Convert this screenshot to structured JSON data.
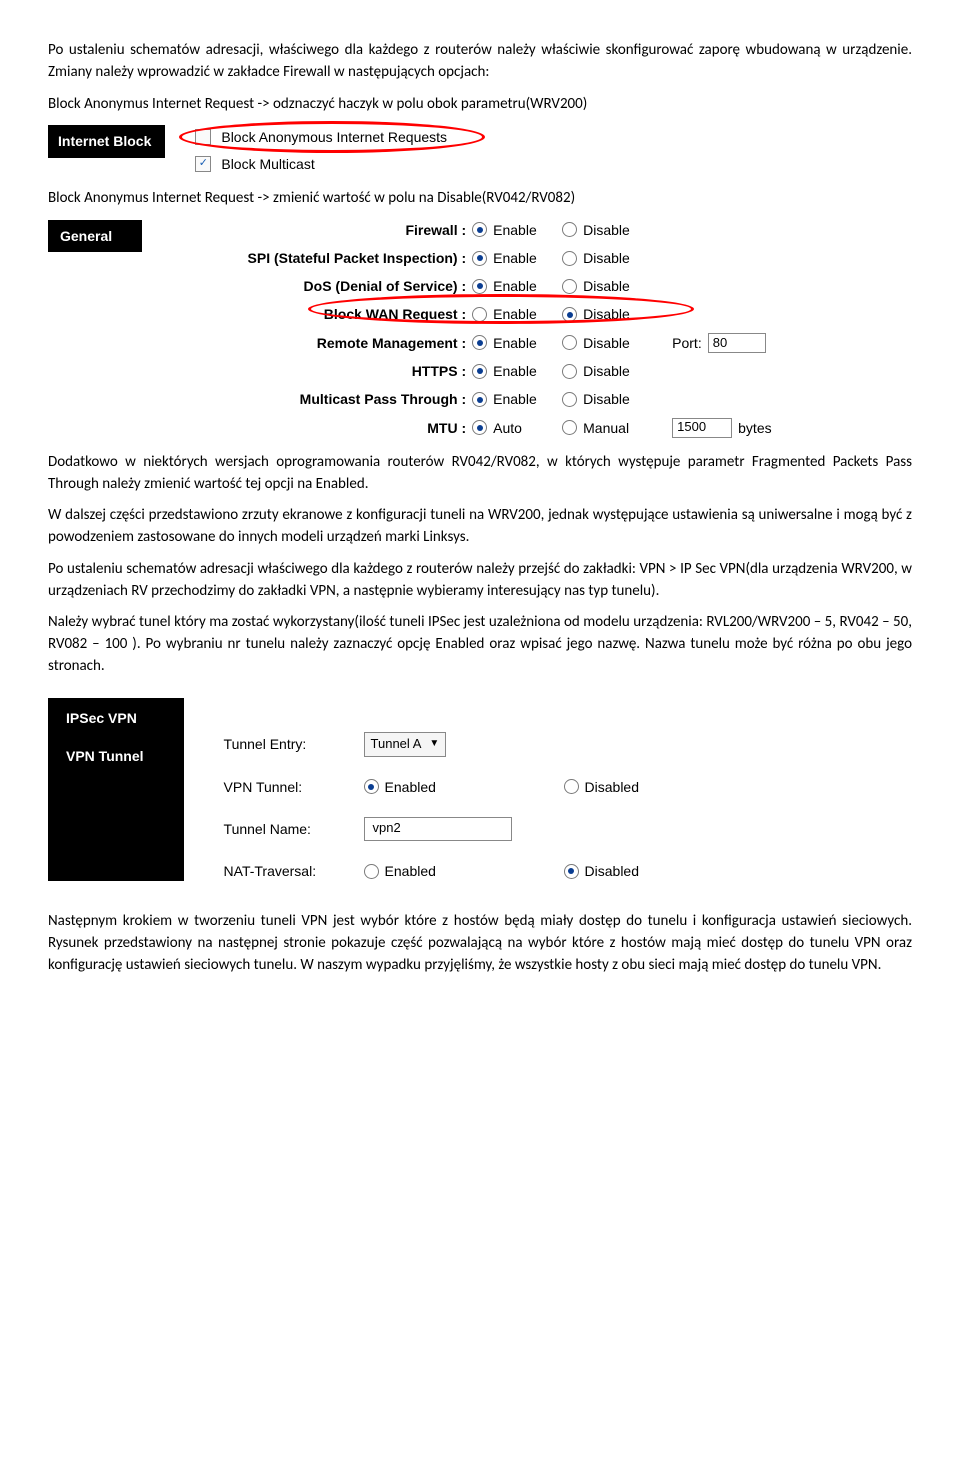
{
  "para1": "Po ustaleniu schematów adresacji, właściwego dla każdego z routerów należy właściwie skonfigurować zaporę wbudowaną w urządzenie. Zmiany należy wprowadzić w zakładce Firewall w następujących opcjach:",
  "para2": "Block Anonymus Internet Request -> odznaczyć haczyk w polu obok parametru(WRV200)",
  "fig1": {
    "left": "Internet Block",
    "row1": "Block Anonymous Internet Requests",
    "row2": "Block Multicast"
  },
  "para3": "Block Anonymus Internet Request -> zmienić wartość w polu na Disable(RV042/RV082)",
  "fig2": {
    "left": "General",
    "rows": [
      {
        "label": "Firewall :",
        "opt1": "Enable",
        "opt2": "Disable",
        "sel": 0
      },
      {
        "label": "SPI (Stateful Packet Inspection) :",
        "opt1": "Enable",
        "opt2": "Disable",
        "sel": 0
      },
      {
        "label": "DoS (Denial of Service) :",
        "opt1": "Enable",
        "opt2": "Disable",
        "sel": 0
      },
      {
        "label": "Block WAN Request :",
        "opt1": "Enable",
        "opt2": "Disable",
        "sel": 1
      },
      {
        "label": "Remote Management :",
        "opt1": "Enable",
        "opt2": "Disable",
        "sel": 0,
        "extra": "Port:",
        "extra_val": "80"
      },
      {
        "label": "HTTPS :",
        "opt1": "Enable",
        "opt2": "Disable",
        "sel": 0
      },
      {
        "label": "Multicast Pass Through :",
        "opt1": "Enable",
        "opt2": "Disable",
        "sel": 0
      },
      {
        "label": "MTU :",
        "opt1": "Auto",
        "opt2": "Manual",
        "sel": 0,
        "extra_val": "1500",
        "extra_suffix": "bytes"
      }
    ]
  },
  "para4": "Dodatkowo w niektórych wersjach oprogramowania routerów RV042/RV082, w których występuje parametr Fragmented Packets Pass Through należy  zmienić wartość tej opcji  na Enabled.",
  "para5": "W dalszej części przedstawiono zrzuty ekranowe z konfiguracji tuneli na WRV200, jednak występujące ustawienia są uniwersalne i mogą być z powodzeniem zastosowane do innych modeli urządzeń marki Linksys.",
  "para6": "Po ustaleniu schematów adresacji właściwego dla każdego z routerów należy przejść do zakładki: VPN > IP Sec VPN(dla urządzenia WRV200, w urządzeniach RV przechodzimy do zakładki VPN, a następnie wybieramy interesujący nas typ tunelu).",
  "para7": "Należy wybrać tunel który ma zostać wykorzystany(ilość tuneli IPSec jest uzależniona od modelu urządzenia: RVL200/WRV200 – 5, RV042 – 50, RV082 – 100 ). Po wybraniu nr tunelu należy zaznaczyć opcję Enabled oraz wpisać jego nazwę. Nazwa tunelu może być różna po obu jego stronach.",
  "fig3": {
    "title": "IPSec VPN",
    "sub": "VPN Tunnel",
    "rows": {
      "tunnel_entry_label": "Tunnel Entry:",
      "tunnel_entry_value": "Tunnel A",
      "vpn_tunnel_label": "VPN Tunnel:",
      "enabled": "Enabled",
      "disabled": "Disabled",
      "tunnel_name_label": "Tunnel Name:",
      "tunnel_name_value": "vpn2",
      "nat_label": "NAT-Traversal:"
    }
  },
  "para8": "Następnym krokiem w tworzeniu tuneli VPN jest wybór które z hostów będą miały dostęp do tunelu i konfiguracja ustawień sieciowych. Rysunek przedstawiony na następnej stronie pokazuje część pozwalającą na wybór które z hostów mają mieć dostęp do tunelu VPN oraz konfigurację ustawień sieciowych tunelu. W naszym wypadku przyjęliśmy, że wszystkie hosty z obu sieci mają mieć dostęp do tunelu VPN."
}
